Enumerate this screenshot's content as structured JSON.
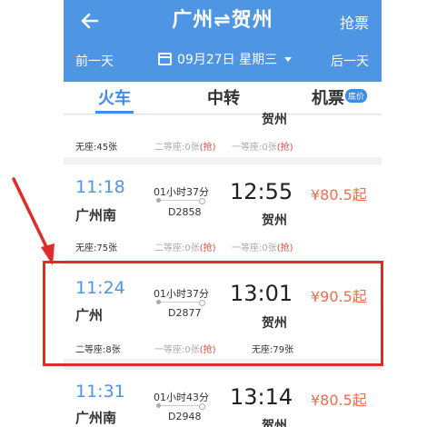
{
  "header": {
    "back_icon": "left-arrow-icon",
    "title": "广州⇌贺州",
    "rob_ticket": "抢票",
    "prev_day": "前一天",
    "date": "09月27日 星期三",
    "next_day": "后一天"
  },
  "tabs": [
    {
      "label": "火车"
    },
    {
      "label": "中转"
    },
    {
      "label": "机票",
      "badge": "底价"
    }
  ],
  "partial_card": {
    "arr_station": "贺州",
    "seats": [
      {
        "label": "无座:45张",
        "muted": false
      },
      {
        "label": "二等座:0张",
        "rob": "(抢)",
        "muted": true
      },
      {
        "label": "一等座:0张",
        "rob": "(抢)",
        "muted": true
      }
    ]
  },
  "trains": [
    {
      "dep_time": "11:18",
      "dep_station": "广州南",
      "duration": "01小时37分",
      "train_no": "D2858",
      "arr_time": "12:55",
      "arr_station": "贺州",
      "price": "¥80.5起",
      "seats": [
        {
          "label": "无座:75张",
          "muted": false
        },
        {
          "label": "二等座:0张",
          "rob": "(抢)",
          "muted": true
        },
        {
          "label": "一等座:0张",
          "rob": "(抢)",
          "muted": true
        }
      ]
    },
    {
      "dep_time": "11:24",
      "dep_station": "广州",
      "duration": "01小时37分",
      "train_no": "D2877",
      "arr_time": "13:01",
      "arr_station": "贺州",
      "price": "¥90.5起",
      "seats": [
        {
          "label": "二等座:8张",
          "muted": false
        },
        {
          "label": "一等座:0张",
          "rob": "(抢)",
          "muted": true
        },
        {
          "label": "无座:79张",
          "muted": false
        }
      ]
    },
    {
      "dep_time": "11:31",
      "dep_station": "广州南",
      "duration": "01小时43分",
      "train_no": "D2948",
      "arr_time": "13:14",
      "arr_station": "贺州",
      "price": "¥80.5起"
    }
  ],
  "colors": {
    "header_bg": "#4e95e4",
    "accent_blue": "#3d8ce6",
    "price_red": "#f26b4f",
    "annotation_red": "#e02b2b"
  }
}
